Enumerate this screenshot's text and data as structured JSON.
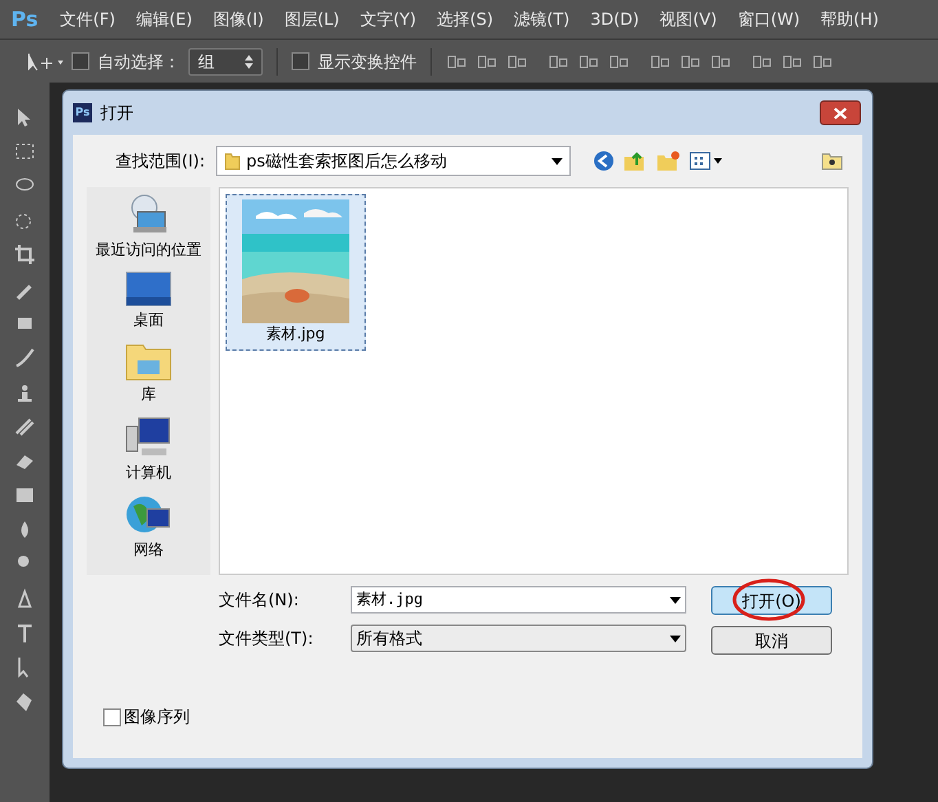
{
  "app": {
    "logo": "Ps"
  },
  "menu": [
    "文件(F)",
    "编辑(E)",
    "图像(I)",
    "图层(L)",
    "文字(Y)",
    "选择(S)",
    "滤镜(T)",
    "3D(D)",
    "视图(V)",
    "窗口(W)",
    "帮助(H)"
  ],
  "options_bar": {
    "auto_select": {
      "label": "自动选择：",
      "checked": false
    },
    "target": {
      "value": "组"
    },
    "show_transform": {
      "label": "显示变换控件",
      "checked": false
    }
  },
  "dialog": {
    "title": "打开",
    "icon": "Ps",
    "look_in": {
      "label": "查找范围(I):",
      "value": "ps磁性套索抠图后怎么移动"
    },
    "places": [
      {
        "label": "最近访问的位置",
        "kind": "recent"
      },
      {
        "label": "桌面",
        "kind": "desktop"
      },
      {
        "label": "库",
        "kind": "library"
      },
      {
        "label": "计算机",
        "kind": "computer"
      },
      {
        "label": "网络",
        "kind": "network"
      }
    ],
    "files": [
      {
        "name": "素材.jpg",
        "selected": true,
        "kind": "picture"
      }
    ],
    "file_name": {
      "label": "文件名(N):",
      "value": "素材.jpg"
    },
    "file_type": {
      "label": "文件类型(T):",
      "value": "所有格式"
    },
    "buttons": [
      {
        "label": "打开(O)",
        "kind": "primary",
        "circled": true
      },
      {
        "label": "取消",
        "kind": "normal",
        "circled": false
      }
    ],
    "image_sequence": {
      "label": "图像序列",
      "checked": false
    }
  }
}
